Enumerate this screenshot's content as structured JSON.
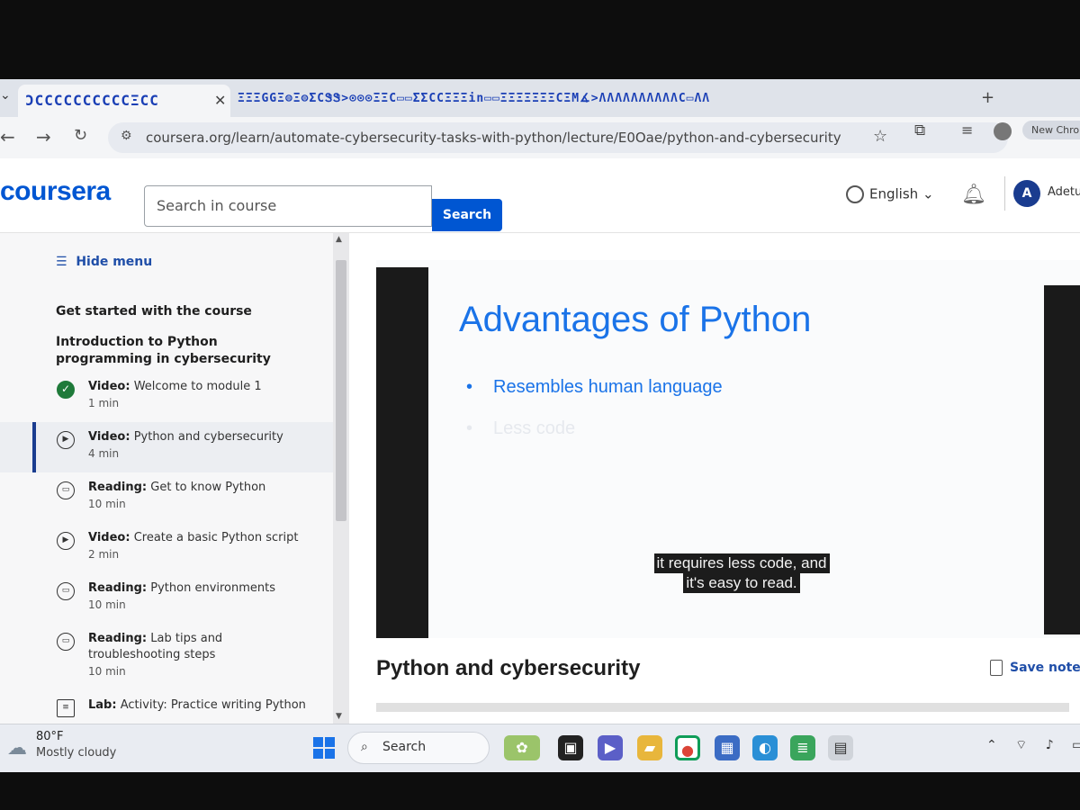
{
  "browser": {
    "active_tab_title": "ƆCCCCCCCCCCΞCC",
    "other_tabs_strip": "ΞΞΞGGΞ⊜Ξ⊜ΣCᏕᏕ>⊙⊙⊙ΞΞC▭▭ΣΣCCΞΞΞin▭▭ΞΞΞΞΞΞΞCΞM∡>ΛΛΛΛΛΛΛΛΛΛC▭ΛΛ",
    "url": "coursera.org/learn/automate-cybersecurity-tasks-with-python/lecture/E0Oae/python-and-cybersecurity",
    "new_chrome_label": "New Chron",
    "icons": [
      "chevron-down-icon",
      "close-icon",
      "plus-icon",
      "back-icon",
      "forward-icon",
      "reload-icon",
      "site-info-icon",
      "star-icon",
      "extensions-icon",
      "media-icon",
      "profile-icon"
    ]
  },
  "header": {
    "logo": "coursera",
    "search_placeholder": "Search in course",
    "search_button": "Search",
    "language": "English",
    "avatar_initial": "A",
    "user_name": "Adetu"
  },
  "sidebar": {
    "hide_menu": "Hide menu",
    "sections": [
      "Get started with the course",
      "Introduction to Python programming in cybersecurity"
    ],
    "items": [
      {
        "type": "Video:",
        "title": "Welcome to module 1",
        "duration": "1 min",
        "state": "completed"
      },
      {
        "type": "Video:",
        "title": "Python and cybersecurity",
        "duration": "4 min",
        "state": "active"
      },
      {
        "type": "Reading:",
        "title": "Get to know Python",
        "duration": "10 min",
        "state": "reading"
      },
      {
        "type": "Video:",
        "title": "Create a basic Python script",
        "duration": "2 min",
        "state": "video"
      },
      {
        "type": "Reading:",
        "title": "Python environments",
        "duration": "10 min",
        "state": "reading"
      },
      {
        "type": "Reading:",
        "title": "Lab tips and troubleshooting steps",
        "duration": "10 min",
        "state": "reading"
      },
      {
        "type": "Lab:",
        "title": "Activity: Practice writing Python",
        "duration": "",
        "state": "lab"
      }
    ]
  },
  "slide": {
    "title": "Advantages of Python",
    "bullets": [
      "Resembles human language",
      "Less code"
    ]
  },
  "caption": {
    "line1": "it requires less code, and",
    "line2": "it's easy to read."
  },
  "lesson": {
    "title": "Python and cybersecurity",
    "save_note": "Save note"
  },
  "taskbar": {
    "temperature": "80°F",
    "weather": "Mostly cloudy",
    "search": "Search"
  },
  "colors": {
    "brand": "#0056d2",
    "slide_blue": "#1a73e8",
    "active_bar": "#1a3c8f",
    "completed_green": "#1f7a3a"
  }
}
